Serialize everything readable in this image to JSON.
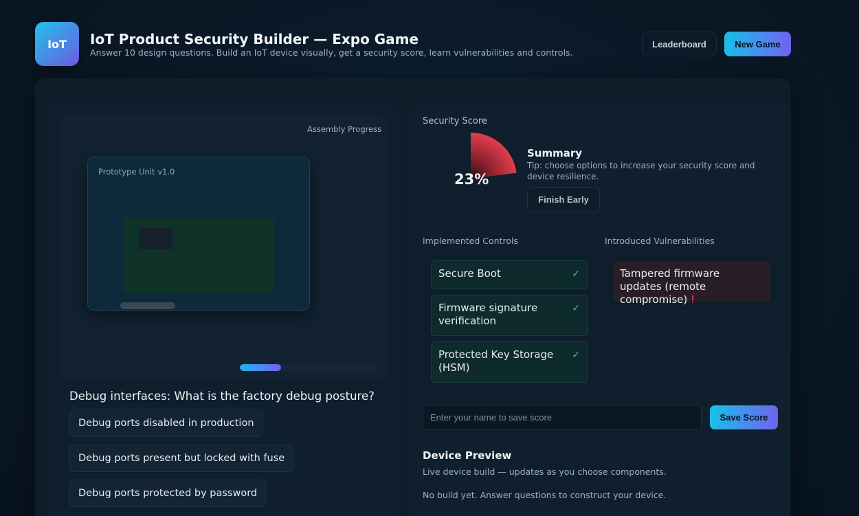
{
  "header": {
    "logo_text": "IoT",
    "title": "IoT Product Security Builder — Expo Game",
    "subtitle": "Answer 10 design questions. Build an IoT device visually, get a security score, learn vulnerabilities and controls.",
    "leaderboard_label": "Leaderboard",
    "new_game_label": "New Game"
  },
  "builder": {
    "assembly_label": "Assembly Progress",
    "prototype_label": "Prototype Unit v1.0",
    "progress_fraction": 0.3
  },
  "question": {
    "text": "Debug interfaces: What is the factory debug posture?",
    "options": [
      "Debug ports disabled in production",
      "Debug ports present but locked with fuse",
      "Debug ports protected by password"
    ]
  },
  "score": {
    "label": "Security Score",
    "value_text": "23%",
    "value_fraction": 0.23,
    "summary_title": "Summary",
    "summary_tip": "Tip: choose options to increase your security score and device resilience.",
    "finish_label": "Finish Early"
  },
  "controls": {
    "title": "Implemented Controls",
    "items": [
      "Secure Boot",
      "Firmware signature verification",
      "Protected Key Storage (HSM)"
    ],
    "check_glyph": "✓"
  },
  "vulnerabilities": {
    "title": "Introduced Vulnerabilities",
    "items": [
      {
        "text": "Tampered firmware updates (remote compromise)",
        "mark": "!"
      }
    ]
  },
  "save": {
    "placeholder": "Enter your name to save score",
    "button_label": "Save Score"
  },
  "preview": {
    "title": "Device Preview",
    "subtitle": "Live device build — updates as you choose components.",
    "empty_text": "No build yet. Answer questions to construct your device."
  },
  "colors": {
    "accent_start": "#18c0e8",
    "accent_end": "#6f63f0",
    "gauge_red": "#e8414f",
    "success": "#2fd09c",
    "danger": "#ff4d5b"
  }
}
